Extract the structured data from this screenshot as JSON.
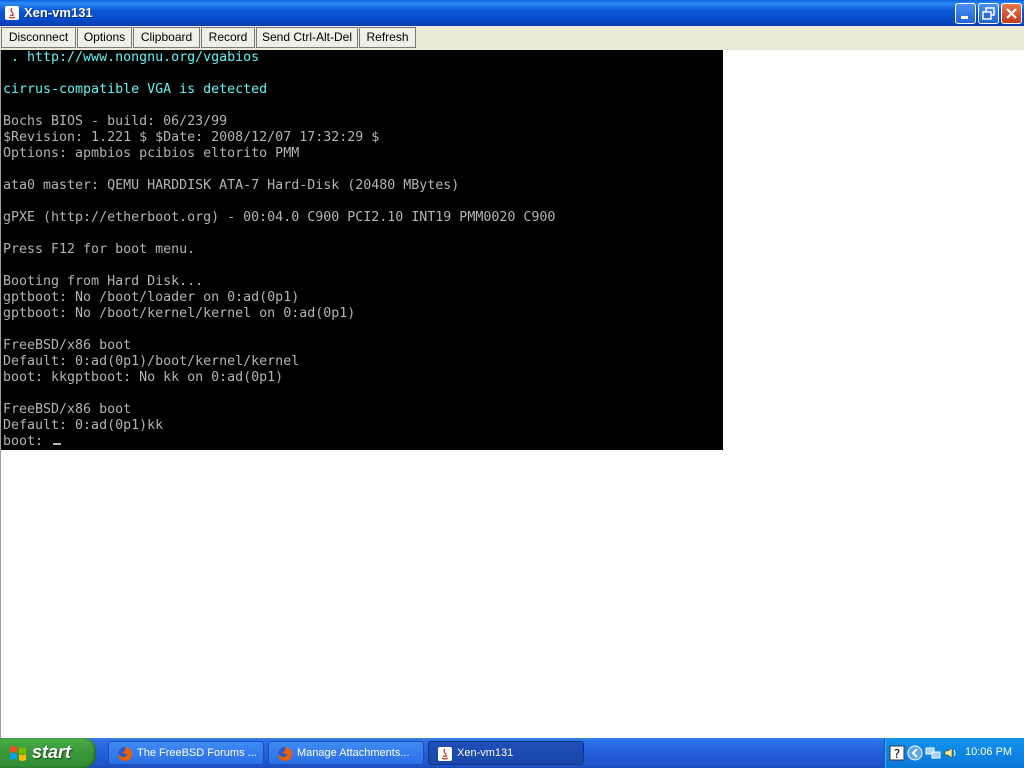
{
  "window": {
    "title": "Xen-vm131"
  },
  "toolbar": {
    "buttons": [
      "Disconnect",
      "Options",
      "Clipboard",
      "Record",
      "Send Ctrl-Alt-Del",
      "Refresh"
    ]
  },
  "console": {
    "lines": [
      " . http://www.nongnu.org/vgabios",
      "",
      "cirrus-compatible VGA is detected",
      "",
      "Bochs BIOS - build: 06/23/99",
      "$Revision: 1.221 $ $Date: 2008/12/07 17:32:29 $",
      "Options: apmbios pcibios eltorito PMM",
      "",
      "ata0 master: QEMU HARDDISK ATA-7 Hard-Disk (20480 MBytes)",
      "",
      "gPXE (http://etherboot.org) - 00:04.0 C900 PCI2.10 INT19 PMM0020 C900",
      "",
      "Press F12 for boot menu.",
      "",
      "Booting from Hard Disk...",
      "gptboot: No /boot/loader on 0:ad(0p1)",
      "gptboot: No /boot/kernel/kernel on 0:ad(0p1)",
      "",
      "FreeBSD/x86 boot",
      "Default: 0:ad(0p1)/boot/kernel/kernel",
      "boot: kkgptboot: No kk on 0:ad(0p1)",
      "",
      "FreeBSD/x86 boot",
      "Default: 0:ad(0p1)kk",
      "boot: "
    ],
    "colors": {
      "text": "#b4b4b4",
      "highlight": "#5ff5f5",
      "background": "#000000"
    }
  },
  "taskbar": {
    "start_label": "start",
    "tasks": [
      {
        "label": "The FreeBSD Forums ...",
        "icon": "firefox-icon"
      },
      {
        "label": "Manage Attachments...",
        "icon": "firefox-icon"
      },
      {
        "label": "Xen-vm131",
        "icon": "java-icon"
      }
    ],
    "clock": "10:06 PM",
    "tray_icons": [
      "help-icon",
      "tray-arrow-icon",
      "network-icon",
      "volume-icon"
    ]
  },
  "colors": {
    "titlebar": "#0a58d8",
    "taskbar": "#245edb",
    "start": "#3c9a3c",
    "tray": "#0b77d8"
  }
}
